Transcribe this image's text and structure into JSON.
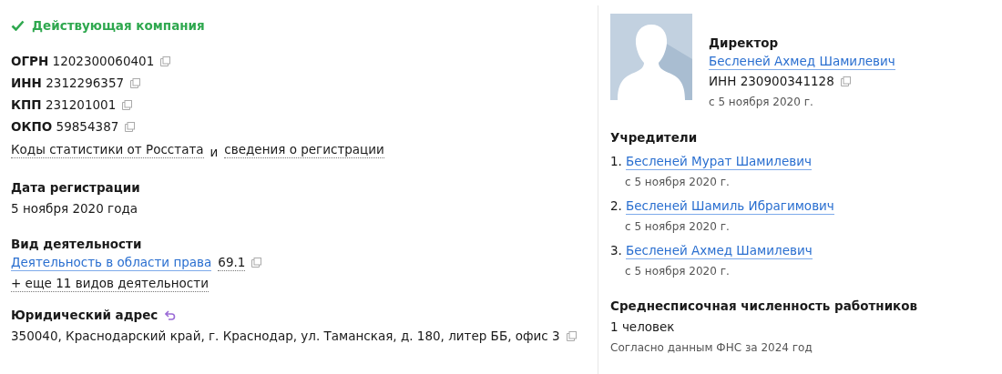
{
  "status": {
    "label": "Действующая компания",
    "active": true
  },
  "identifiers": [
    {
      "label": "ОГРН",
      "value": "1202300060401"
    },
    {
      "label": "ИНН",
      "value": "2312296357"
    },
    {
      "label": "КПП",
      "value": "231201001"
    },
    {
      "label": "ОКПО",
      "value": "59854387"
    }
  ],
  "stat_links": {
    "items": [
      "Коды статистики от Росстата",
      "сведения о регистрации"
    ],
    "joiner": "и"
  },
  "registration": {
    "title": "Дата регистрации",
    "value": "5 ноября 2020 года"
  },
  "activity": {
    "title": "Вид деятельности",
    "main": "Деятельность в области права",
    "code": "69.1",
    "more": "+ еще 11 видов деятельности"
  },
  "address": {
    "title": "Юридический адрес",
    "value": "350040, Краснодарский край, г. Краснодар, ул. Таманская, д. 180, литер ББ, офис 3"
  },
  "director": {
    "title": "Директор",
    "name": "Бесленей Ахмед Шамилевич",
    "inn": "ИНН 230900341128",
    "since": "с 5 ноября 2020 г."
  },
  "founders": {
    "title": "Учредители",
    "items": [
      {
        "number": "1.",
        "name": "Бесленей Мурат Шамилевич",
        "since": "с 5 ноября 2020 г."
      },
      {
        "number": "2.",
        "name": "Бесленей Шамиль Ибрагимович",
        "since": "с 5 ноября 2020 г."
      },
      {
        "number": "3.",
        "name": "Бесленей Ахмед Шамилевич",
        "since": "с 5 ноября 2020 г."
      }
    ]
  },
  "employees": {
    "title": "Среднесписочная численность работников",
    "value": "1 человек",
    "note": "Согласно данным ФНС за 2024 год"
  }
}
